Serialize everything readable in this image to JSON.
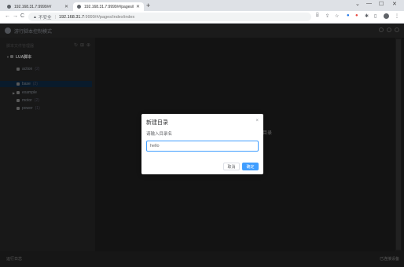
{
  "browser": {
    "tabs": [
      {
        "title": "192.168.31.7:9999/#/",
        "active": false
      },
      {
        "title": "192.168.31.7:9999/#/pages/in...",
        "active": true
      }
    ],
    "new_tab": "+",
    "controls": {
      "minimize": "—",
      "maximize": "☐",
      "close": "✕"
    },
    "back": "←",
    "forward": "→",
    "reload": "C",
    "security_label": "不安全",
    "separator": "|",
    "url_host": "192.168.31.7",
    "url_path": ":9999/#/pages/index/index",
    "extensions": [
      "translate-icon",
      "share-icon",
      "star-icon",
      "ext-blue-icon",
      "ext-red-icon",
      "puzzle-icon",
      "sidepanel-icon",
      "profile-avatar",
      "menu-icon"
    ]
  },
  "app": {
    "title": "游行脚本控制模式",
    "sidebar": {
      "header": "脚本文件管理器",
      "tree": [
        {
          "label": "LUA脚本",
          "count": "",
          "level": 0,
          "expanded": true,
          "root": true
        },
        {
          "label": "action",
          "count": "(2)",
          "level": 1,
          "expanded": false
        },
        {
          "label": "base",
          "count": "(2)",
          "level": 1,
          "expanded": false,
          "selected": true
        },
        {
          "label": "example",
          "count": "",
          "level": 1,
          "expanded": true
        },
        {
          "label": "motor",
          "count": "(2)",
          "level": 1,
          "expanded": false
        },
        {
          "label": "power",
          "count": "(1)",
          "level": 1,
          "expanded": false
        }
      ]
    },
    "background_text": "目录",
    "footer": {
      "left": "运行日志",
      "right": "已连接设备"
    }
  },
  "dialog": {
    "title": "新建目录",
    "close": "×",
    "message": "请输入目录名",
    "input_value": "hello",
    "cancel_label": "取消",
    "confirm_label": "确定"
  },
  "colors": {
    "primary": "#409eff",
    "app_bg": "#1e1e1e",
    "sidebar_bg": "#252526",
    "selection": "#0f2a44"
  }
}
